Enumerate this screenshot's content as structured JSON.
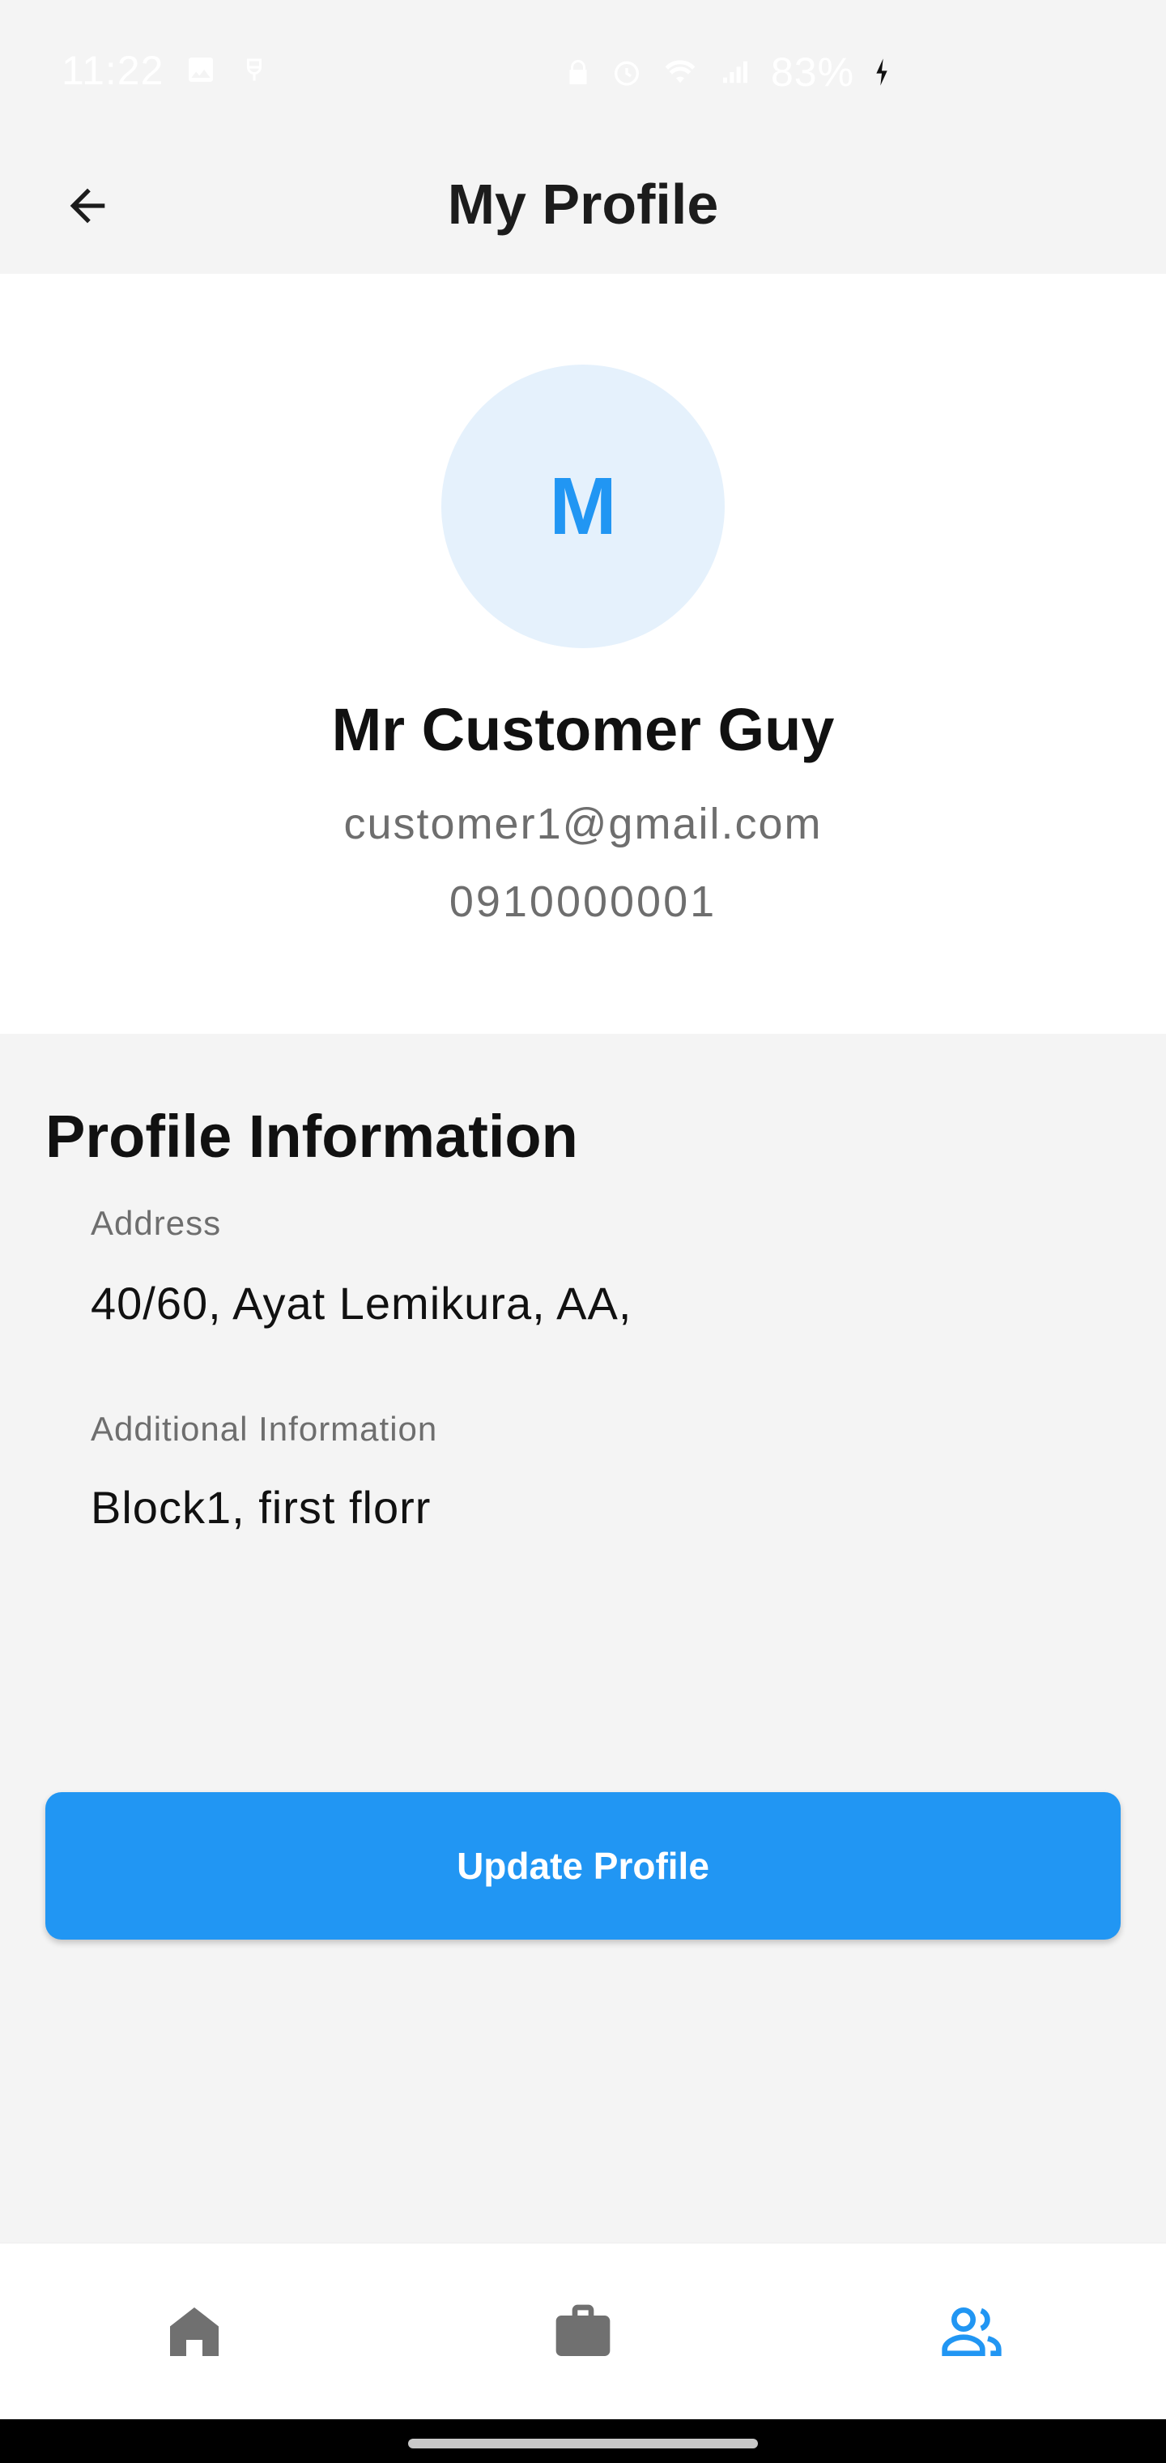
{
  "status_bar": {
    "time": "11:22",
    "battery": "83%"
  },
  "app_bar": {
    "title": "My Profile",
    "back_icon": "arrow-back-icon"
  },
  "profile": {
    "initial": "M",
    "name": "Mr Customer Guy",
    "email": "customer1@gmail.com",
    "phone": "0910000001"
  },
  "profile_info": {
    "title": "Profile Information",
    "fields": [
      {
        "label": "Address",
        "value": "40/60, Ayat Lemikura, AA,"
      },
      {
        "label": "Additional Information",
        "value": "Block1, first florr"
      }
    ]
  },
  "actions": {
    "update_label": "Update Profile"
  },
  "bottom_nav": {
    "items": [
      {
        "icon": "home-icon",
        "active": false
      },
      {
        "icon": "briefcase-icon",
        "active": false
      },
      {
        "icon": "people-icon",
        "active": true
      }
    ]
  },
  "colors": {
    "primary": "#2196f3",
    "avatar_bg": "#e5f1fc",
    "inactive_icon": "#707070",
    "background": "#f4f4f4"
  }
}
